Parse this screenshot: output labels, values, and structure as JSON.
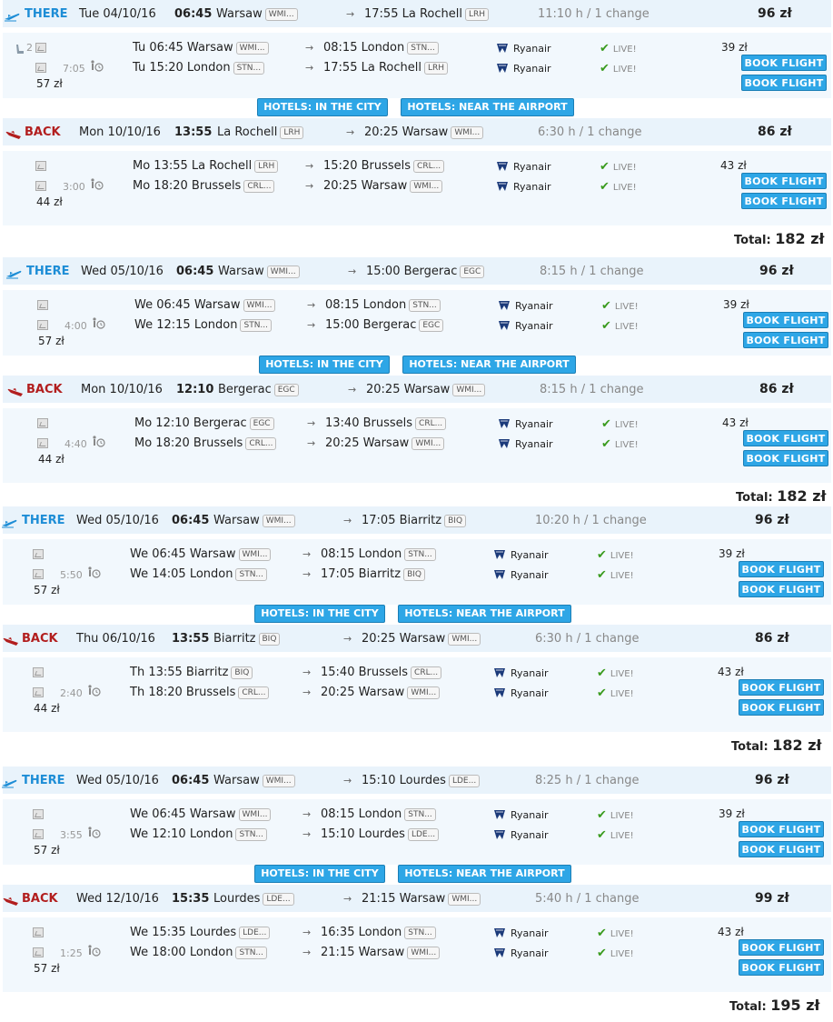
{
  "icons": {
    "there": "plane-takeoff-icon",
    "back": "plane-landing-icon",
    "arrow": "arrow-right-icon",
    "airline": "ryanair-harp-icon",
    "check": "check-icon",
    "layover": "person-wait-clock-icon",
    "image": "image-placeholder-icon",
    "seat": "seat-icon"
  },
  "colors": {
    "accent": "#2ea6e6",
    "there": "#1d8dd6",
    "back": "#b21e1e",
    "live": "#3a9b1e"
  },
  "labels": {
    "book_flight": "BOOK FLIGHT",
    "hotels_city": "HOTELS: IN THE CITY",
    "hotels_airport": "HOTELS: NEAR THE AIRPORT",
    "live": "LIVE!",
    "total": "Total:"
  },
  "results": [
    {
      "there": {
        "dir": "THERE",
        "date": "Tue 04/10/16",
        "time": "06:45",
        "from": "Warsaw",
        "from_code": "WMI...",
        "arr": "17:55",
        "to": "La Rochell",
        "to_code": "LRH",
        "duration": "11:10 h / 1 change",
        "price": "96 zł",
        "seat_count": "2",
        "layover": "7:05",
        "layover_price": "57 zł",
        "seg_price": "39 zł",
        "segments": [
          {
            "dep": "Tu 06:45 Warsaw",
            "dep_code": "WMI...",
            "arr": "08:15 London",
            "arr_code": "STN...",
            "airline": "Ryanair"
          },
          {
            "dep": "Tu 15:20 London",
            "dep_code": "STN...",
            "arr": "17:55 La Rochell",
            "arr_code": "LRH",
            "airline": "Ryanair"
          }
        ]
      },
      "back": {
        "dir": "BACK",
        "date": "Mon 10/10/16",
        "time": "13:55",
        "from": "La Rochell",
        "from_code": "LRH",
        "arr": "20:25",
        "to": "Warsaw",
        "to_code": "WMI...",
        "duration": "6:30 h / 1 change",
        "price": "86 zł",
        "layover": "3:00",
        "layover_price": "44 zł",
        "seg_price": "43 zł",
        "segments": [
          {
            "dep": "Mo 13:55 La Rochell",
            "dep_code": "LRH",
            "arr": "15:20 Brussels",
            "arr_code": "CRL...",
            "airline": "Ryanair"
          },
          {
            "dep": "Mo 18:20 Brussels",
            "dep_code": "CRL...",
            "arr": "20:25 Warsaw",
            "arr_code": "WMI...",
            "airline": "Ryanair"
          }
        ]
      },
      "total": "182 zł"
    },
    {
      "there": {
        "dir": "THERE",
        "date": "Wed 05/10/16",
        "time": "06:45",
        "from": "Warsaw",
        "from_code": "WMI...",
        "arr": "15:00",
        "to": "Bergerac",
        "to_code": "EGC",
        "duration": "8:15 h / 1 change",
        "price": "96 zł",
        "layover": "4:00",
        "layover_price": "57 zł",
        "seg_price": "39 zł",
        "segments": [
          {
            "dep": "We 06:45 Warsaw",
            "dep_code": "WMI...",
            "arr": "08:15 London",
            "arr_code": "STN...",
            "airline": "Ryanair"
          },
          {
            "dep": "We 12:15 London",
            "dep_code": "STN...",
            "arr": "15:00 Bergerac",
            "arr_code": "EGC",
            "airline": "Ryanair"
          }
        ]
      },
      "back": {
        "dir": "BACK",
        "date": "Mon 10/10/16",
        "time": "12:10",
        "from": "Bergerac",
        "from_code": "EGC",
        "arr": "20:25",
        "to": "Warsaw",
        "to_code": "WMI...",
        "duration": "8:15 h / 1 change",
        "price": "86 zł",
        "layover": "4:40",
        "layover_price": "44 zł",
        "seg_price": "43 zł",
        "segments": [
          {
            "dep": "Mo 12:10 Bergerac",
            "dep_code": "EGC",
            "arr": "13:40 Brussels",
            "arr_code": "CRL...",
            "airline": "Ryanair"
          },
          {
            "dep": "Mo 18:20 Brussels",
            "dep_code": "CRL...",
            "arr": "20:25 Warsaw",
            "arr_code": "WMI...",
            "airline": "Ryanair"
          }
        ]
      },
      "total": "182 zł"
    },
    {
      "there": {
        "dir": "THERE",
        "date": "Wed 05/10/16",
        "time": "06:45",
        "from": "Warsaw",
        "from_code": "WMI...",
        "arr": "17:05",
        "to": "Biarritz",
        "to_code": "BIQ",
        "duration": "10:20 h / 1 change",
        "price": "96 zł",
        "layover": "5:50",
        "layover_price": "57 zł",
        "seg_price": "39 zł",
        "segments": [
          {
            "dep": "We 06:45 Warsaw",
            "dep_code": "WMI...",
            "arr": "08:15 London",
            "arr_code": "STN...",
            "airline": "Ryanair"
          },
          {
            "dep": "We 14:05 London",
            "dep_code": "STN...",
            "arr": "17:05 Biarritz",
            "arr_code": "BIQ",
            "airline": "Ryanair"
          }
        ]
      },
      "back": {
        "dir": "BACK",
        "date": "Thu 06/10/16",
        "time": "13:55",
        "from": "Biarritz",
        "from_code": "BIQ",
        "arr": "20:25",
        "to": "Warsaw",
        "to_code": "WMI...",
        "duration": "6:30 h / 1 change",
        "price": "86 zł",
        "layover": "2:40",
        "layover_price": "44 zł",
        "seg_price": "43 zł",
        "segments": [
          {
            "dep": "Th 13:55 Biarritz",
            "dep_code": "BIQ",
            "arr": "15:40 Brussels",
            "arr_code": "CRL...",
            "airline": "Ryanair"
          },
          {
            "dep": "Th 18:20 Brussels",
            "dep_code": "CRL...",
            "arr": "20:25 Warsaw",
            "arr_code": "WMI...",
            "airline": "Ryanair"
          }
        ]
      },
      "total": "182 zł"
    },
    {
      "there": {
        "dir": "THERE",
        "date": "Wed 05/10/16",
        "time": "06:45",
        "from": "Warsaw",
        "from_code": "WMI...",
        "arr": "15:10",
        "to": "Lourdes",
        "to_code": "LDE...",
        "duration": "8:25 h / 1 change",
        "price": "96 zł",
        "layover": "3:55",
        "layover_price": "57 zł",
        "seg_price": "39 zł",
        "segments": [
          {
            "dep": "We 06:45 Warsaw",
            "dep_code": "WMI...",
            "arr": "08:15 London",
            "arr_code": "STN...",
            "airline": "Ryanair"
          },
          {
            "dep": "We 12:10 London",
            "dep_code": "STN...",
            "arr": "15:10 Lourdes",
            "arr_code": "LDE...",
            "airline": "Ryanair"
          }
        ]
      },
      "back": {
        "dir": "BACK",
        "date": "Wed 12/10/16",
        "time": "15:35",
        "from": "Lourdes",
        "from_code": "LDE...",
        "arr": "21:15",
        "to": "Warsaw",
        "to_code": "WMI...",
        "duration": "5:40 h / 1 change",
        "price": "99 zł",
        "layover": "1:25",
        "layover_price": "57 zł",
        "seg_price": "43 zł",
        "segments": [
          {
            "dep": "We 15:35 Lourdes",
            "dep_code": "LDE...",
            "arr": "16:35 London",
            "arr_code": "STN...",
            "airline": "Ryanair"
          },
          {
            "dep": "We 18:00 London",
            "dep_code": "STN...",
            "arr": "21:15 Warsaw",
            "arr_code": "WMI...",
            "airline": "Ryanair"
          }
        ]
      },
      "total": "195 zł"
    }
  ]
}
